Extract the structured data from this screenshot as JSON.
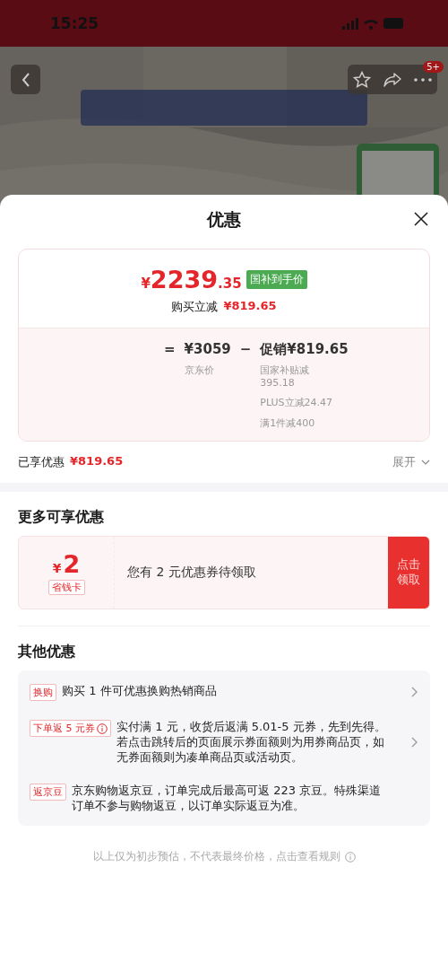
{
  "status_bar": {
    "time": "15:25"
  },
  "product_header": {
    "badge": "5+"
  },
  "sheet": {
    "title": "优惠",
    "price_card": {
      "currency": "¥",
      "price_int": "2239",
      "price_dec": ".35",
      "price_tag": "国补到手价",
      "saving_label": "购买立减",
      "saving_value": "¥819.65",
      "formula": {
        "equals": "=",
        "base_price": "¥3059",
        "base_label": "京东价",
        "minus": "−",
        "promo": "促销¥819.65",
        "promo_details": [
          "国家补贴减\n395.18",
          "PLUS立减24.47",
          "满1件减400"
        ]
      }
    },
    "enjoyed": {
      "label": "已享优惠",
      "value": "¥819.65",
      "expand": "展开",
      "expanded": false
    },
    "more_section": {
      "title": "更多可享优惠",
      "coupon": {
        "currency": "¥",
        "amount": "2",
        "card_tag": "省钱卡",
        "text": "您有 2 元优惠券待领取",
        "button": "点击领取"
      }
    },
    "other_section": {
      "title": "其他优惠",
      "items": [
        {
          "tag": "换购",
          "info": false,
          "text": "购买 1 件可优惠换购热销商品",
          "arrow": true
        },
        {
          "tag": "下单返 5 元券",
          "info": true,
          "text": "实付满 1 元，收货后返满 5.01-5 元券，先到先得。若点击跳转后的页面展示券面额则为用券商品页，如无券面额则为凑单商品页或活动页。",
          "arrow": true
        },
        {
          "tag": "返京豆",
          "info": false,
          "text": "京东购物返京豆，订单完成后最高可返 223 京豆。特殊渠道订单不参与购物返豆，以订单实际返豆为准。",
          "arrow": false
        }
      ]
    },
    "footer_note": "以上仅为初步预估，不代表最终价格，点击查看规则"
  }
}
